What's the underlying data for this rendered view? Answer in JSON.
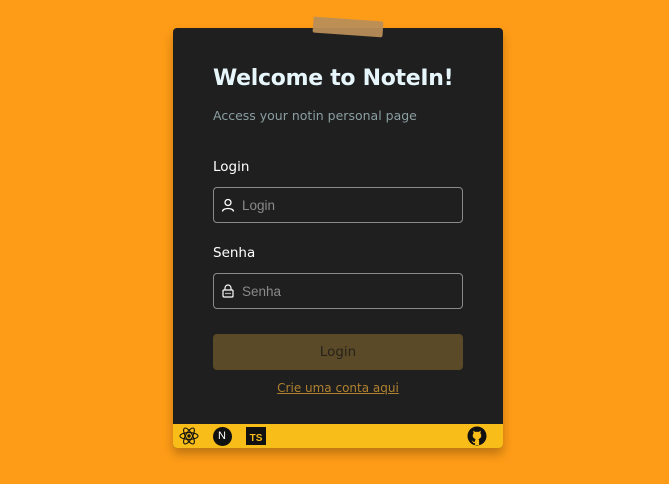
{
  "colors": {
    "background": "#fe9c17",
    "card": "#1f1f1f",
    "footer": "#f9bd19",
    "button": "#5a4a27",
    "link": "#b0812f"
  },
  "card": {
    "title": "Welcome to NoteIn!",
    "subtitle": "Access your notin personal page"
  },
  "form": {
    "login_label": "Login",
    "login_placeholder": "Login",
    "login_icon": "user-icon",
    "password_label": "Senha",
    "password_placeholder": "Senha",
    "password_icon": "lock-icon",
    "submit_label": "Login",
    "signup_link": "Crie uma conta aqui"
  },
  "footer": {
    "icons": [
      "react-icon",
      "nextjs-icon",
      "typescript-icon",
      "github-icon"
    ],
    "next_letter": "N",
    "ts_text": "TS"
  }
}
